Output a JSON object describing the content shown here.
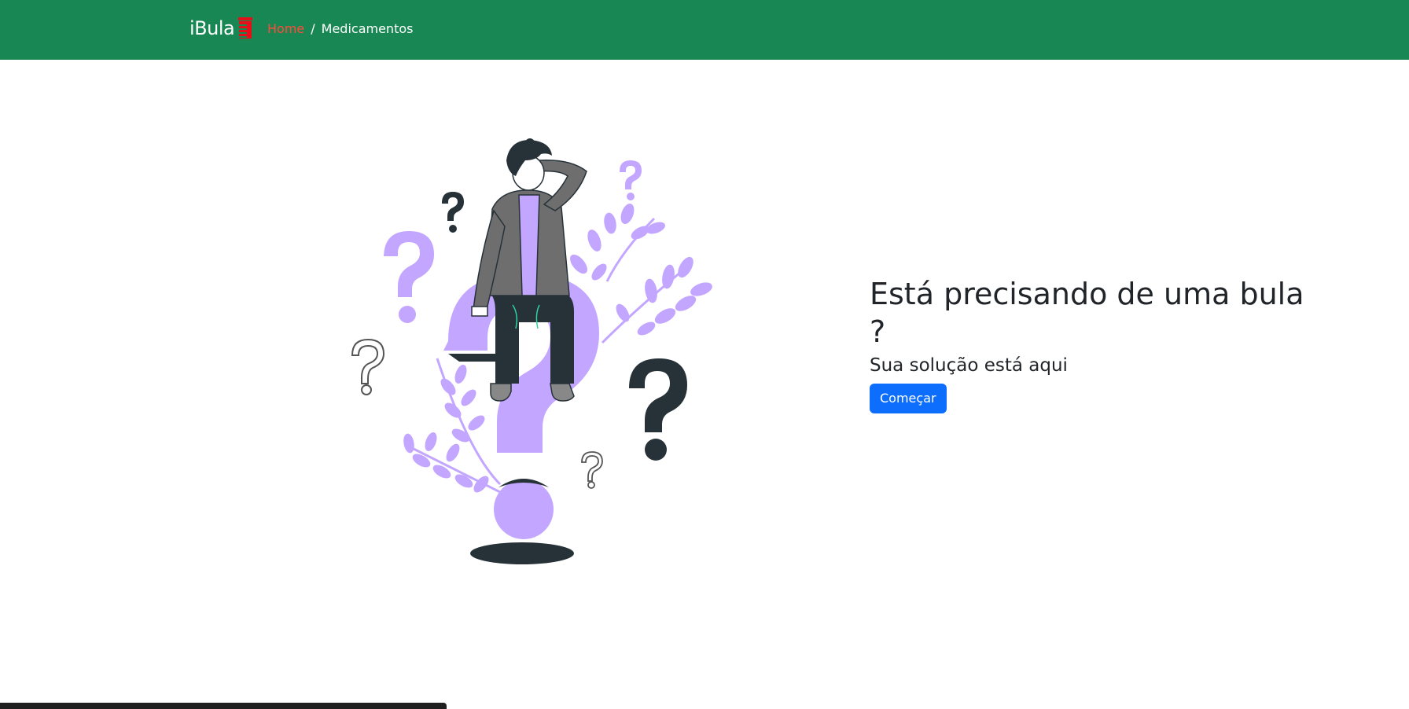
{
  "navbar": {
    "brand": "iBula",
    "brand_icon": "pill-bottle-icon",
    "breadcrumb": {
      "home": "Home",
      "separator": "/",
      "current": "Medicamentos"
    },
    "colors": {
      "background": "#198754",
      "home_link": "#ff4b3a",
      "brand_icon": "#e3101a"
    }
  },
  "illustration": {
    "name": "confused-person-illustration",
    "colors": {
      "purple": "#c3a6ff",
      "dark": "#263238"
    }
  },
  "hero": {
    "title": "Está precisando de uma bula ?",
    "subtitle": "Sua solução está aqui",
    "button_label": "Começar",
    "button_color": "#0d6efd"
  }
}
